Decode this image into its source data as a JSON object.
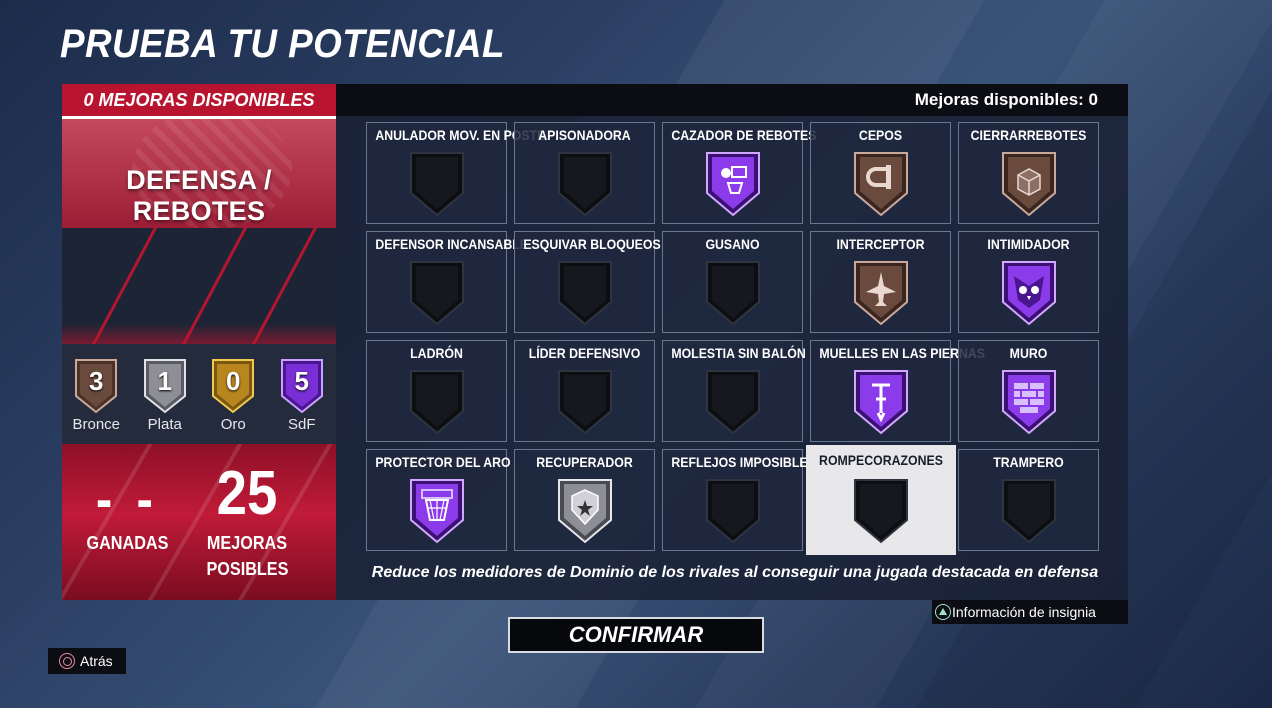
{
  "page_title": "PRUEBA TU POTENCIAL",
  "left_panel": {
    "header": "0 MEJORAS DISPONIBLES",
    "category": "DEFENSA / REBOTES",
    "tiers": [
      {
        "value": "3",
        "label": "Bronce",
        "color": "#6b4a3e"
      },
      {
        "value": "1",
        "label": "Plata",
        "color": "#8e8e96"
      },
      {
        "value": "0",
        "label": "Oro",
        "color": "#b8861e"
      },
      {
        "value": "5",
        "label": "SdF",
        "color": "#7a2fd6"
      }
    ],
    "won_value": "- -",
    "won_label": "GANADAS",
    "possible_value": "25",
    "possible_label": "MEJORAS POSIBLES"
  },
  "right_panel": {
    "available_label": "Mejoras disponibles: 0",
    "badges": [
      {
        "name": "ANULADOR MOV. EN POSTE",
        "tier": "none"
      },
      {
        "name": "APISONADORA",
        "tier": "none"
      },
      {
        "name": "CAZADOR DE REBOTES",
        "tier": "hof",
        "icon": "rebound-hoop-icon"
      },
      {
        "name": "CEPOS",
        "tier": "bronze",
        "icon": "clamp-icon"
      },
      {
        "name": "CIERRARREBOTES",
        "tier": "bronze",
        "icon": "box-icon"
      },
      {
        "name": "DEFENSOR INCANSABLE",
        "tier": "none"
      },
      {
        "name": "ESQUIVAR BLOQUEOS",
        "tier": "none"
      },
      {
        "name": "GUSANO",
        "tier": "none"
      },
      {
        "name": "INTERCEPTOR",
        "tier": "bronze",
        "icon": "jet-icon"
      },
      {
        "name": "INTIMIDADOR",
        "tier": "hof",
        "icon": "owl-icon"
      },
      {
        "name": "LADRÓN",
        "tier": "none"
      },
      {
        "name": "LÍDER DEFENSIVO",
        "tier": "none"
      },
      {
        "name": "MOLESTIA SIN BALÓN",
        "tier": "none"
      },
      {
        "name": "MUELLES EN LAS PIERNAS",
        "tier": "hof",
        "icon": "pogo-icon"
      },
      {
        "name": "MURO",
        "tier": "hof",
        "icon": "brick-wall-icon"
      },
      {
        "name": "PROTECTOR DEL ARO",
        "tier": "hof",
        "icon": "hoop-net-icon"
      },
      {
        "name": "RECUPERADOR",
        "tier": "silver",
        "icon": "police-badge-icon"
      },
      {
        "name": "REFLEJOS IMPOSIBLES",
        "tier": "none"
      },
      {
        "name": "ROMPECORAZONES",
        "tier": "none",
        "selected": true
      },
      {
        "name": "TRAMPERO",
        "tier": "none"
      }
    ],
    "description": "Reduce los medidores de Dominio de los rivales al conseguir una jugada destacada en defensa"
  },
  "info_button": {
    "label": "Información de insignia",
    "icon": "triangle-button-icon"
  },
  "confirm_button": {
    "label": "CONFIRMAR"
  },
  "back_button": {
    "label": "Atrás",
    "icon": "circle-button-icon"
  },
  "colors": {
    "accent_red": "#b8142f",
    "hof_purple": "#8b3bea",
    "bronze": "#6b4a3e",
    "silver": "#9a9aa3"
  }
}
